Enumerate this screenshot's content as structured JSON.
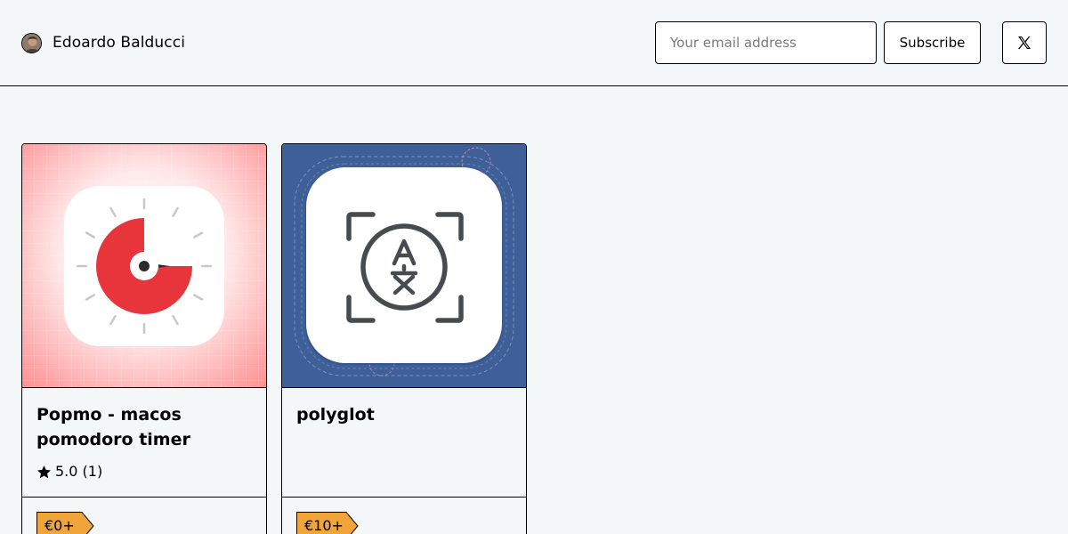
{
  "header": {
    "profile_name": "Edoardo Balducci",
    "email_placeholder": "Your email address",
    "subscribe_label": "Subscribe",
    "social_icon": "x-twitter-icon"
  },
  "products": [
    {
      "title": "Popmo - macos pomodoro timer",
      "rating": "5.0 (1)",
      "price": "€0+",
      "image_icon": "pomodoro-timer-icon",
      "accent_color": "#e8353c"
    },
    {
      "title": "polyglot",
      "rating": "",
      "price": "€10+",
      "image_icon": "translate-icon",
      "accent_color": "#3f5f99"
    }
  ],
  "colors": {
    "background": "#f4f7f8",
    "price_tag": "#f1a43a"
  }
}
